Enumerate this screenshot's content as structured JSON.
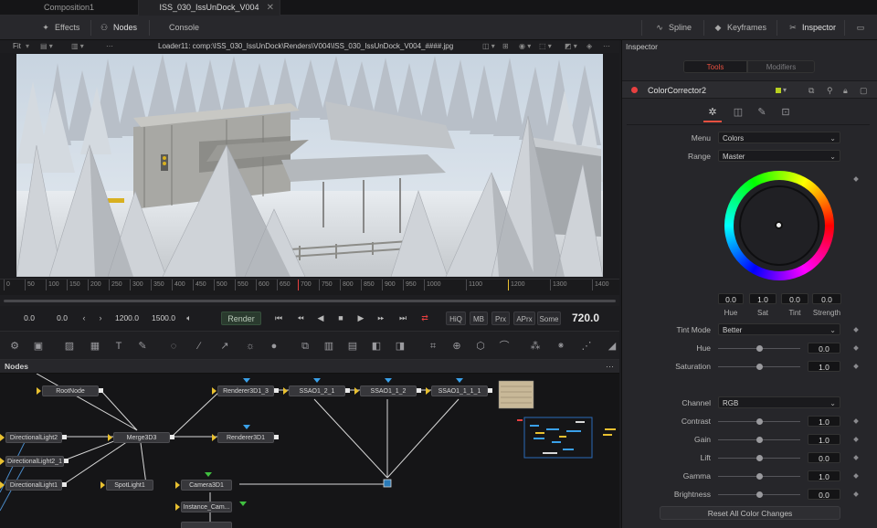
{
  "tabs": [
    {
      "label": "Composition1",
      "active": false
    },
    {
      "label": "ISS_030_IssUnDock_V004",
      "active": true
    }
  ],
  "toolbar": {
    "effects": "Effects",
    "nodes": "Nodes",
    "console": "Console",
    "spline": "Spline",
    "keyframes": "Keyframes",
    "inspector": "Inspector"
  },
  "viewer": {
    "fit": "Fit",
    "title": "Loader11: comp:\\ISS_030_IssUnDock\\Renders\\V004\\ISS_030_IssUnDock_V004_####.jpg"
  },
  "ruler": [
    "0",
    "50",
    "100",
    "150",
    "200",
    "250",
    "300",
    "350",
    "400",
    "450",
    "500",
    "550",
    "600",
    "650",
    "700",
    "750",
    "800",
    "850",
    "900",
    "950",
    "1000",
    "1100",
    "1200",
    "1300",
    "1400"
  ],
  "transport": {
    "start": "0.0",
    "current": "0.0",
    "range_start": "1200.0",
    "range_end": "1500.0",
    "render": "Render",
    "hiq": "HiQ",
    "mb": "MB",
    "prx": "Prx",
    "aprx": "APrx",
    "some": "Some",
    "time": "720.0"
  },
  "nodes_panel": {
    "title": "Nodes",
    "nodes": {
      "root": "RootNode",
      "dl2": "DirectionalLight2",
      "dl21": "DirectionalLight2_1",
      "dl1": "DirectionalLight1",
      "merge": "Merge3D3",
      "spot": "SpotLight1",
      "camera": "Camera3D1",
      "instcam": "Instance_Cam...",
      "r3d13": "Renderer3D1_3",
      "r3d1": "Renderer3D1",
      "ssao1": "SSAO1_2_1",
      "ssao2": "SSAO1_1_2",
      "ssao3": "SSAO1_1_1_1"
    }
  },
  "inspector": {
    "title": "Inspector",
    "tools_tab": "Tools",
    "modifiers_tab": "Modifiers",
    "tool_name": "ColorCorrector2",
    "menu_label": "Menu",
    "menu_value": "Colors",
    "range_label": "Range",
    "range_value": "Master",
    "wheel": {
      "hue": "0.0",
      "sat": "1.0",
      "tint": "0.0",
      "strength": "0.0",
      "hue_lbl": "Hue",
      "sat_lbl": "Sat",
      "tint_lbl": "Tint",
      "strength_lbl": "Strength"
    },
    "tint_mode_label": "Tint Mode",
    "tint_mode_value": "Better",
    "hue_label": "Hue",
    "hue_value": "0.0",
    "saturation_label": "Saturation",
    "saturation_value": "1.0",
    "channel_label": "Channel",
    "channel_value": "RGB",
    "contrast_label": "Contrast",
    "contrast_value": "1.0",
    "gain_label": "Gain",
    "gain_value": "1.0",
    "lift_label": "Lift",
    "lift_value": "0.0",
    "gamma_label": "Gamma",
    "gamma_value": "1.0",
    "brightness_label": "Brightness",
    "brightness_value": "0.0",
    "reset": "Reset All Color Changes"
  },
  "colors": {
    "accent_red": "#e84040",
    "tools_active": "#e85040",
    "pin_yellow": "#e8c030",
    "pin_blue": "#3aa0e8",
    "pin_green": "#40c040"
  }
}
